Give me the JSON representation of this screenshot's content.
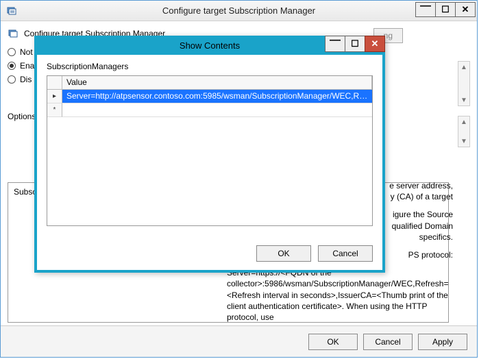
{
  "parent": {
    "title": "Configure target Subscription Manager",
    "header_label": "Configure target Subscription Manager",
    "ghost_button": "ng",
    "radios": {
      "not": "Not",
      "ena": "Ena",
      "dis": "Dis"
    },
    "options_label": "Options",
    "pane_partial_label": "Subscr",
    "footer": {
      "ok": "OK",
      "cancel": "Cancel",
      "apply": "Apply"
    }
  },
  "help": {
    "p1a": "e server address,",
    "p1b": "y (CA) of a target",
    "p2a": "igure the Source",
    "p2b": "qualified Domain",
    "p2c": " specifics.",
    "p3a": "PS protocol:",
    "p3b": "Server=https://<FQDN of the collector>:5986/wsman/SubscriptionManager/WEC,Refresh=<Refresh interval in seconds>,IssuerCA=<Thumb print of the client authentication certificate>. When using the HTTP protocol, use"
  },
  "modal": {
    "title": "Show Contents",
    "grid_label": "SubscriptionManagers",
    "col_header": "Value",
    "row_marker": "▸",
    "new_marker": "*",
    "rows": [
      "Server=http://atpsensor.contoso.com:5985/wsman/SubscriptionManager/WEC,Re..."
    ],
    "footer": {
      "ok": "OK",
      "cancel": "Cancel"
    }
  }
}
